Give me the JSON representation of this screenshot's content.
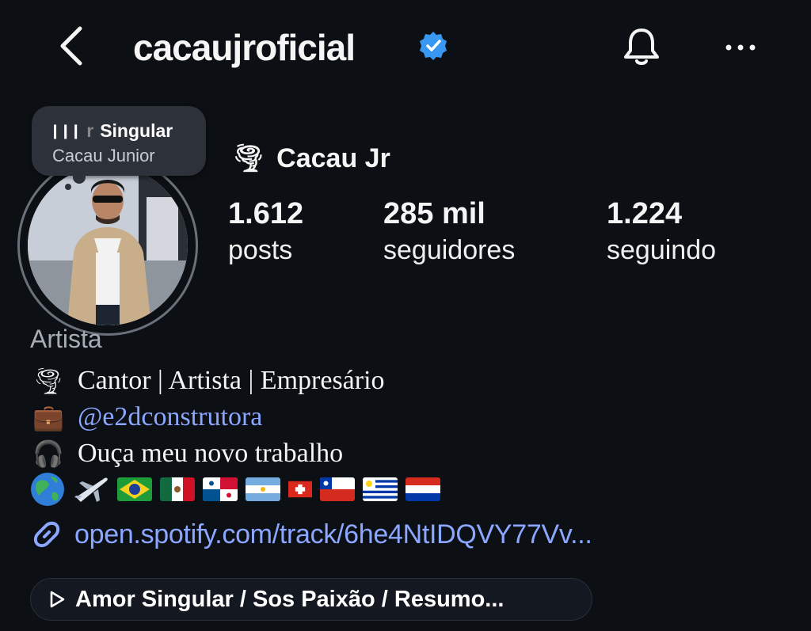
{
  "header": {
    "username": "cacaujroficial",
    "back_icon": "chevron-left-icon",
    "verified_icon": "verified-badge-icon",
    "bell_icon": "bell-icon",
    "more_icon": "more-horizontal-icon"
  },
  "note": {
    "line1_prefix": "r",
    "line1": "Singular",
    "line2": "Cacau Junior"
  },
  "profile": {
    "display_name": "Cacau Jr",
    "name_emoji": "🌪",
    "stats": [
      {
        "value": "1.612",
        "label": "posts"
      },
      {
        "value": "285 mil",
        "label": "seguidores"
      },
      {
        "value": "1.224",
        "label": "seguindo"
      }
    ],
    "category": "Artista",
    "bio": [
      {
        "emoji": "🌪",
        "text": "Cantor | Artista | Empresário"
      },
      {
        "emoji": "💼",
        "text": "@e2dconstrutora"
      },
      {
        "emoji": "🎧",
        "text": "Ouça meu novo trabalho"
      }
    ],
    "link": "open.spotify.com/track/6he4NtIDQVY77Vv...",
    "music": "Amor Singular / Sos Paixão / Resumo..."
  },
  "colors": {
    "background": "#0c0f14",
    "link": "#8ba7ff",
    "verified": "#3897f0"
  }
}
